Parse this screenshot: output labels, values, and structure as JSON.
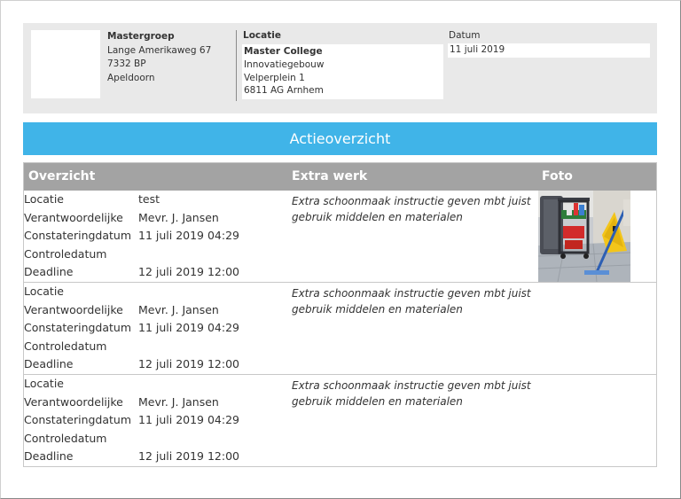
{
  "header": {
    "company": {
      "name": "Mastergroep",
      "street": "Lange Amerikaweg 67",
      "postcode": "7332 BP",
      "city": "Apeldoorn"
    },
    "location": {
      "label": "Locatie",
      "name": "Master College",
      "building": "Innovatiegebouw",
      "street": "Velperplein 1",
      "postcode_city": "6811 AG Arnhem"
    },
    "date": {
      "label": "Datum",
      "value": "11 juli 2019"
    }
  },
  "banner": {
    "title": "Actieoverzicht"
  },
  "table": {
    "columns": [
      "Overzicht",
      "Extra werk",
      "Foto"
    ],
    "rows": [
      {
        "fields": [
          {
            "label": "Locatie",
            "value": "test"
          },
          {
            "label": "Verantwoordelijke",
            "value": "Mevr. J. Jansen"
          },
          {
            "label": "Constateringdatum",
            "value": "11 juli 2019 04:29"
          },
          {
            "label": "Controledatum",
            "value": ""
          },
          {
            "label": "Deadline",
            "value": "12 juli 2019 12:00"
          }
        ],
        "extra_work": "Extra schoonmaak instructie geven mbt juist gebruik middelen en materialen",
        "has_photo": true
      },
      {
        "fields": [
          {
            "label": "Locatie",
            "value": ""
          },
          {
            "label": "Verantwoordelijke",
            "value": "Mevr. J. Jansen"
          },
          {
            "label": "Constateringdatum",
            "value": "11 juli 2019 04:29"
          },
          {
            "label": "Controledatum",
            "value": ""
          },
          {
            "label": "Deadline",
            "value": "12 juli 2019 12:00"
          }
        ],
        "extra_work": "Extra schoonmaak instructie geven mbt juist gebruik middelen en materialen",
        "has_photo": false
      },
      {
        "fields": [
          {
            "label": "Locatie",
            "value": ""
          },
          {
            "label": "Verantwoordelijke",
            "value": "Mevr. J. Jansen"
          },
          {
            "label": "Constateringdatum",
            "value": "11 juli 2019 04:29"
          },
          {
            "label": "Controledatum",
            "value": ""
          },
          {
            "label": "Deadline",
            "value": "12 juli 2019 12:00"
          }
        ],
        "extra_work": "Extra schoonmaak instructie geven mbt juist gebruik middelen en materialen",
        "has_photo": false
      }
    ]
  },
  "colors": {
    "banner": "#40b4e8",
    "table_header": "#a3a3a3",
    "header_bg": "#e9e9e9"
  }
}
